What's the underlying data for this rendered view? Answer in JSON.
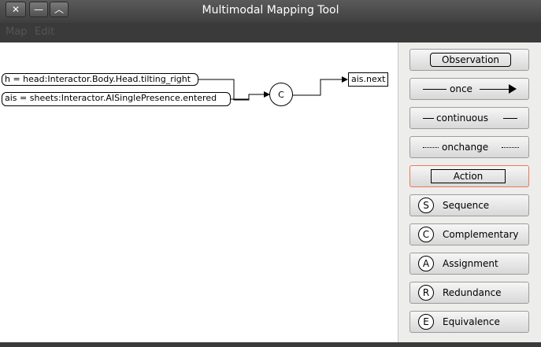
{
  "window": {
    "title": "Multimodal Mapping Tool"
  },
  "menu": {
    "items": [
      "Map",
      "Edit"
    ]
  },
  "canvas": {
    "nodes": {
      "observation_h": "h = head:Interactor.Body.Head.tilting_right",
      "observation_ais": "ais = sheets:Interactor.AISinglePresence.entered",
      "operator": "C",
      "action": "ais.next"
    }
  },
  "palette": {
    "observation": "Observation",
    "once": "once",
    "continuous": "continuous",
    "onchange": "onchange",
    "action": "Action",
    "sequence": {
      "letter": "S",
      "label": "Sequence"
    },
    "complementary": {
      "letter": "C",
      "label": "Complementary"
    },
    "assignment": {
      "letter": "A",
      "label": "Assignment"
    },
    "redundance": {
      "letter": "R",
      "label": "Redundance"
    },
    "equivalence": {
      "letter": "E",
      "label": "Equivalence"
    }
  },
  "colors": {
    "titlebar": "#4a4a4a",
    "canvas": "#ffffff",
    "sidebar": "#ededec",
    "active_border": "#e87a55"
  },
  "icons": {
    "close": "close-icon",
    "minimize": "minimize-icon",
    "maximize": "maximize-icon"
  }
}
